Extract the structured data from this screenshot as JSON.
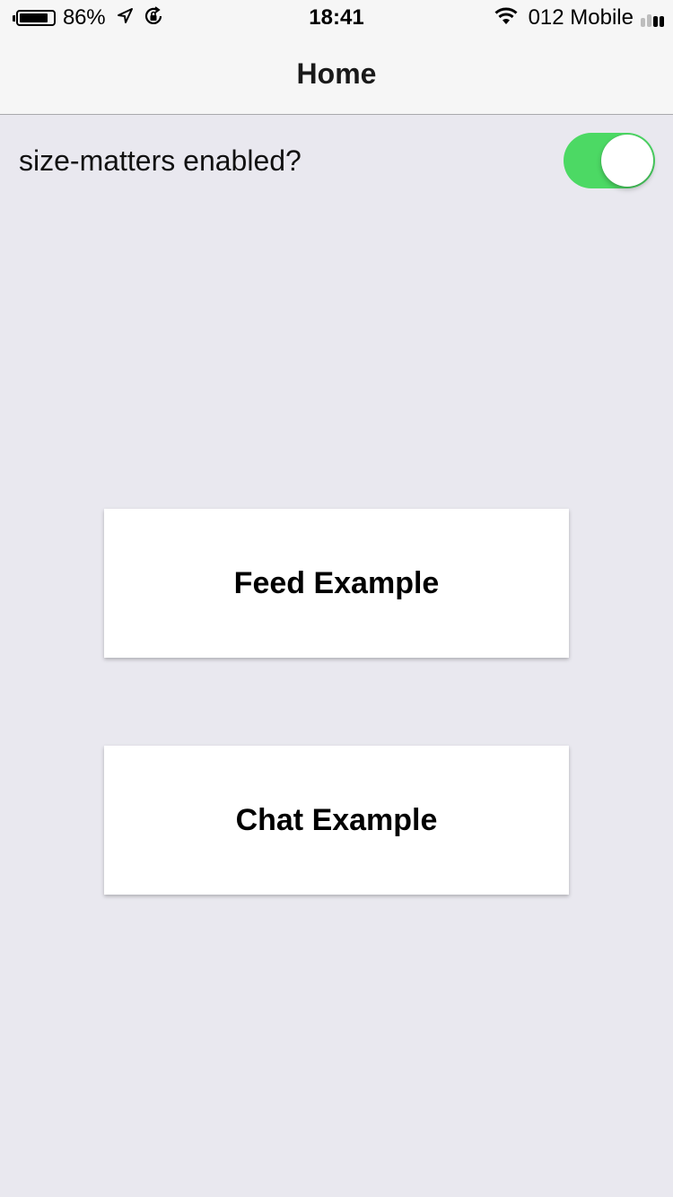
{
  "status_bar": {
    "battery_percent": "86%",
    "battery_level": 0.86,
    "time": "18:41",
    "carrier": "012 Mobile",
    "signal_bars_total": 4,
    "signal_bars_filled": 2,
    "icons": [
      "battery-icon",
      "location-arrow-icon",
      "orientation-lock-icon",
      "wifi-icon",
      "signal-icon"
    ]
  },
  "nav": {
    "title": "Home"
  },
  "settings": {
    "toggle_label": "size-matters enabled?",
    "toggle_on": true,
    "toggle_color": "#4cd964"
  },
  "buttons": {
    "feed_label": "Feed Example",
    "chat_label": "Chat Example"
  },
  "colors": {
    "background": "#e9e8ef",
    "bar_background": "#f6f6f6",
    "card_background": "#ffffff"
  }
}
